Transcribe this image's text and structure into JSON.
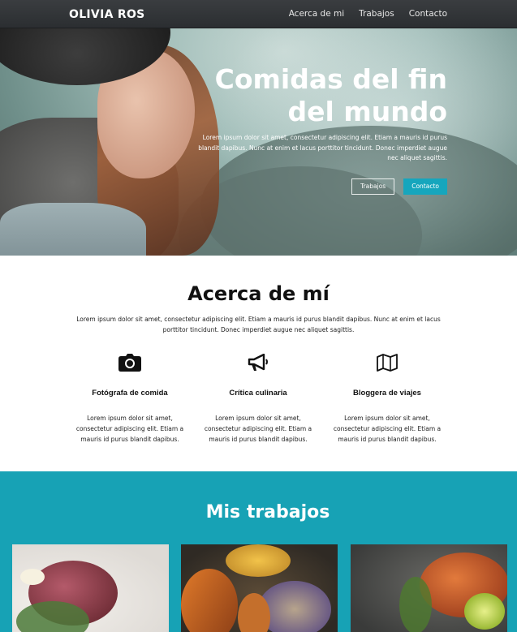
{
  "nav": {
    "brand": "OLIVIA ROS",
    "links": [
      "Acerca de mi",
      "Trabajos",
      "Contacto"
    ]
  },
  "hero": {
    "title_line1": "Comidas del fin",
    "title_line2": "del mundo",
    "text": "Lorem ipsum dolor sit amet, consectetur adipiscing elit. Etiam a mauris id purus blandit dapibus. Nunc at enim et lacus porttitor tincidunt. Donec imperdiet augue nec aliquet sagittis.",
    "btn_works": "Trabajos",
    "btn_contact": "Contacto"
  },
  "about": {
    "title": "Acerca de mí",
    "text": "Lorem ipsum dolor sit amet, consectetur adipiscing elit. Etiam a mauris id purus blandit dapibus. Nunc at enim et lacus porttitor tincidunt. Donec imperdiet augue nec aliquet sagittis.",
    "features": [
      {
        "icon": "camera-icon",
        "title": "Fotógrafa de comida",
        "text": "Lorem ipsum dolor sit amet, consectetur adipiscing elit. Etiam a mauris id purus blandit dapibus."
      },
      {
        "icon": "megaphone-icon",
        "title": "Crítica culinaria",
        "text": "Lorem ipsum dolor sit amet, consectetur adipiscing elit. Etiam a mauris id purus blandit dapibus."
      },
      {
        "icon": "map-icon",
        "title": "Bloggera de viajes",
        "text": "Lorem ipsum dolor sit amet, consectetur adipiscing elit. Etiam a mauris id purus blandit dapibus."
      }
    ]
  },
  "works": {
    "title": "Mis trabajos"
  },
  "colors": {
    "accent": "#16a6bd",
    "works_bg": "#17a2b5",
    "navbar": "#2f3235"
  }
}
